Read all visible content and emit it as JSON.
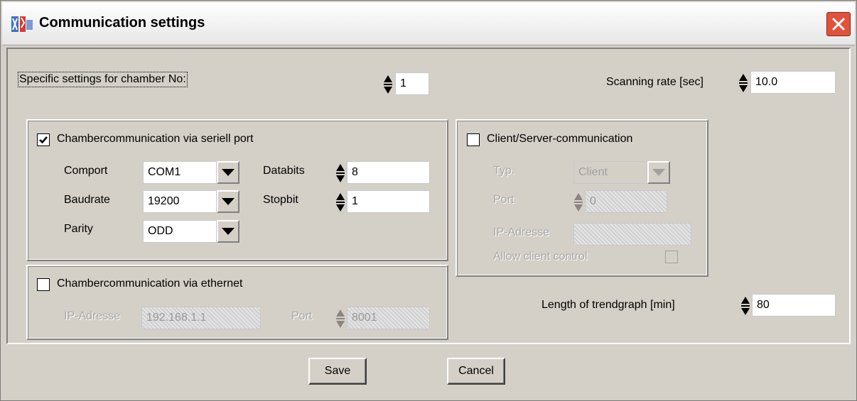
{
  "window": {
    "title": "Communication settings",
    "close_label": "✕"
  },
  "chamber": {
    "label": "Specific settings for chamber No:",
    "value": "1"
  },
  "scanning": {
    "label": "Scanning rate [sec]",
    "value": "10.0"
  },
  "serial": {
    "checkbox_label": "Chambercommunication via seriell port",
    "checked": true,
    "comport": {
      "label": "Comport",
      "value": "COM1"
    },
    "baudrate": {
      "label": "Baudrate",
      "value": "19200"
    },
    "parity": {
      "label": "Parity",
      "value": "ODD"
    },
    "databits": {
      "label": "Databits",
      "value": "8"
    },
    "stopbit": {
      "label": "Stopbit",
      "value": "1"
    }
  },
  "ethernet": {
    "checkbox_label": "Chambercommunication via ethernet",
    "checked": false,
    "ip_label": "IP-Adresse",
    "ip_value": "192.168.1.1",
    "port_label": "Port",
    "port_value": "8001"
  },
  "clientserver": {
    "checkbox_label": "Client/Server-communication",
    "checked": false,
    "typ_label": "Typ.",
    "typ_value": "Client",
    "port_label": "Port",
    "port_value": "0",
    "ip_label": "IP-Adresse",
    "ip_value": "",
    "allow_label": "Allow client control"
  },
  "trend": {
    "label": "Length of trendgraph [min]",
    "value": "80"
  },
  "buttons": {
    "save": "Save",
    "cancel": "Cancel"
  },
  "colors": {
    "dialog_bg": "#d4d0c8",
    "close_button": "#e0533a"
  }
}
